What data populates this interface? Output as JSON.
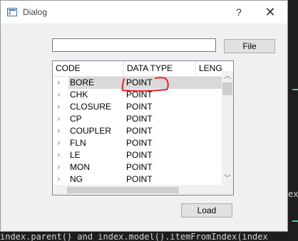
{
  "dialog": {
    "title": "Dialog",
    "help_label": "?",
    "close_label": "✕"
  },
  "path_input": {
    "value": "",
    "placeholder": ""
  },
  "file_button": {
    "label": "File"
  },
  "table": {
    "columns": [
      "CODE",
      "DATA TYPE",
      "LENGTH"
    ],
    "rows": [
      {
        "code": "BORE",
        "type": "POINT",
        "selected": true
      },
      {
        "code": "CHK",
        "type": "POINT"
      },
      {
        "code": "CLOSURE",
        "type": "POINT"
      },
      {
        "code": "CP",
        "type": "POINT"
      },
      {
        "code": "COUPLER",
        "type": "POINT"
      },
      {
        "code": "FLN",
        "type": "POINT"
      },
      {
        "code": "LE",
        "type": "POINT"
      },
      {
        "code": "MON",
        "type": "POINT"
      },
      {
        "code": "NG",
        "type": "POINT"
      }
    ]
  },
  "load_button": {
    "label": "Load"
  },
  "background_code": {
    "line": "index.parent() and index.model().itemFromIndex(index",
    "edge_text": "ex"
  },
  "colors": {
    "annotation": "#e8222e",
    "selection": "#d9d9d9",
    "editor_background": "#1e1e1e"
  },
  "icons": {
    "app": "window-icon",
    "expand": "chevron-right-icon",
    "scroll_up": "chevron-up-icon",
    "scroll_down": "chevron-down-icon"
  }
}
